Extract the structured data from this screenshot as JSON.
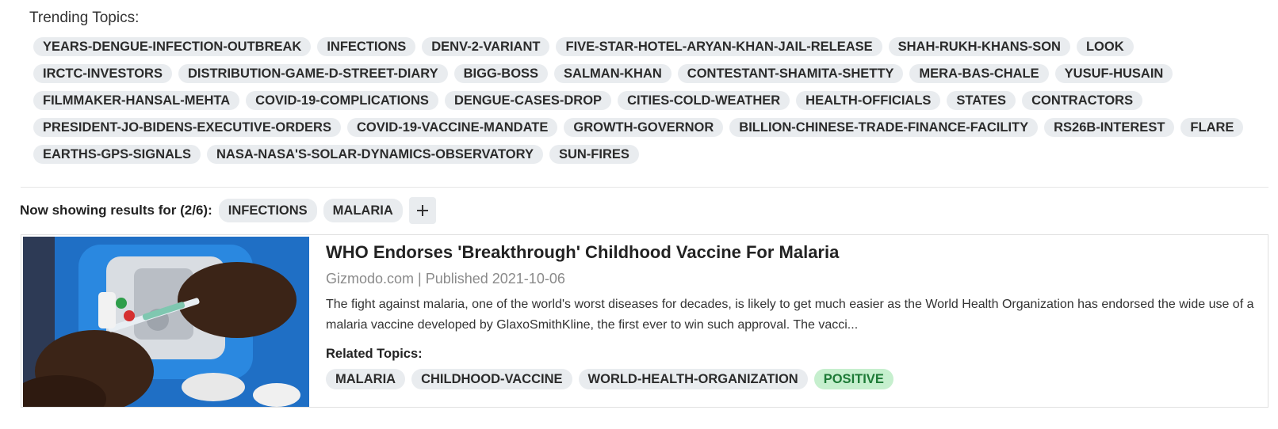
{
  "trending": {
    "title": "Trending Topics:",
    "topics": [
      "YEARS-DENGUE-INFECTION-OUTBREAK",
      "INFECTIONS",
      "DENV-2-VARIANT",
      "FIVE-STAR-HOTEL-ARYAN-KHAN-JAIL-RELEASE",
      "SHAH-RUKH-KHANS-SON",
      "LOOK",
      "IRCTC-INVESTORS",
      "DISTRIBUTION-GAME-D-STREET-DIARY",
      "BIGG-BOSS",
      "SALMAN-KHAN",
      "CONTESTANT-SHAMITA-SHETTY",
      "MERA-BAS-CHALE",
      "YUSUF-HUSAIN",
      "FILMMAKER-HANSAL-MEHTA",
      "COVID-19-COMPLICATIONS",
      "DENGUE-CASES-DROP",
      "CITIES-COLD-WEATHER",
      "HEALTH-OFFICIALS",
      "STATES",
      "CONTRACTORS",
      "PRESIDENT-JO-BIDENS-EXECUTIVE-ORDERS",
      "COVID-19-VACCINE-MANDATE",
      "GROWTH-GOVERNOR",
      "BILLION-CHINESE-TRADE-FINANCE-FACILITY",
      "RS26B-INTEREST",
      "FLARE",
      "EARTHS-GPS-SIGNALS",
      "NASA-NASA'S-SOLAR-DYNAMICS-OBSERVATORY",
      "SUN-FIRES"
    ]
  },
  "filter": {
    "label": "Now showing results for (2/6):",
    "selected": [
      "INFECTIONS",
      "MALARIA"
    ],
    "add_icon": "plus-icon"
  },
  "article": {
    "headline": "WHO Endorses 'Breakthrough' Childhood Vaccine For Malaria",
    "meta": "Gizmodo.com | Published 2021-10-06",
    "summary": "The fight against malaria, one of the world's worst diseases for decades, is likely to get much easier as the World Health Organization has endorsed the wide use of a malaria vaccine developed by GlaxoSmithKline, the first ever to win such approval. The vacci...",
    "related_label": "Related Topics:",
    "related_topics": [
      "MALARIA",
      "CHILDHOOD-VACCINE",
      "WORLD-HEALTH-ORGANIZATION"
    ],
    "sentiment": "POSITIVE",
    "image_icon": "vaccine-photo"
  },
  "colors": {
    "chip_bg": "#e9ecef",
    "positive_bg": "#c6efce",
    "positive_text": "#1d7a36"
  }
}
